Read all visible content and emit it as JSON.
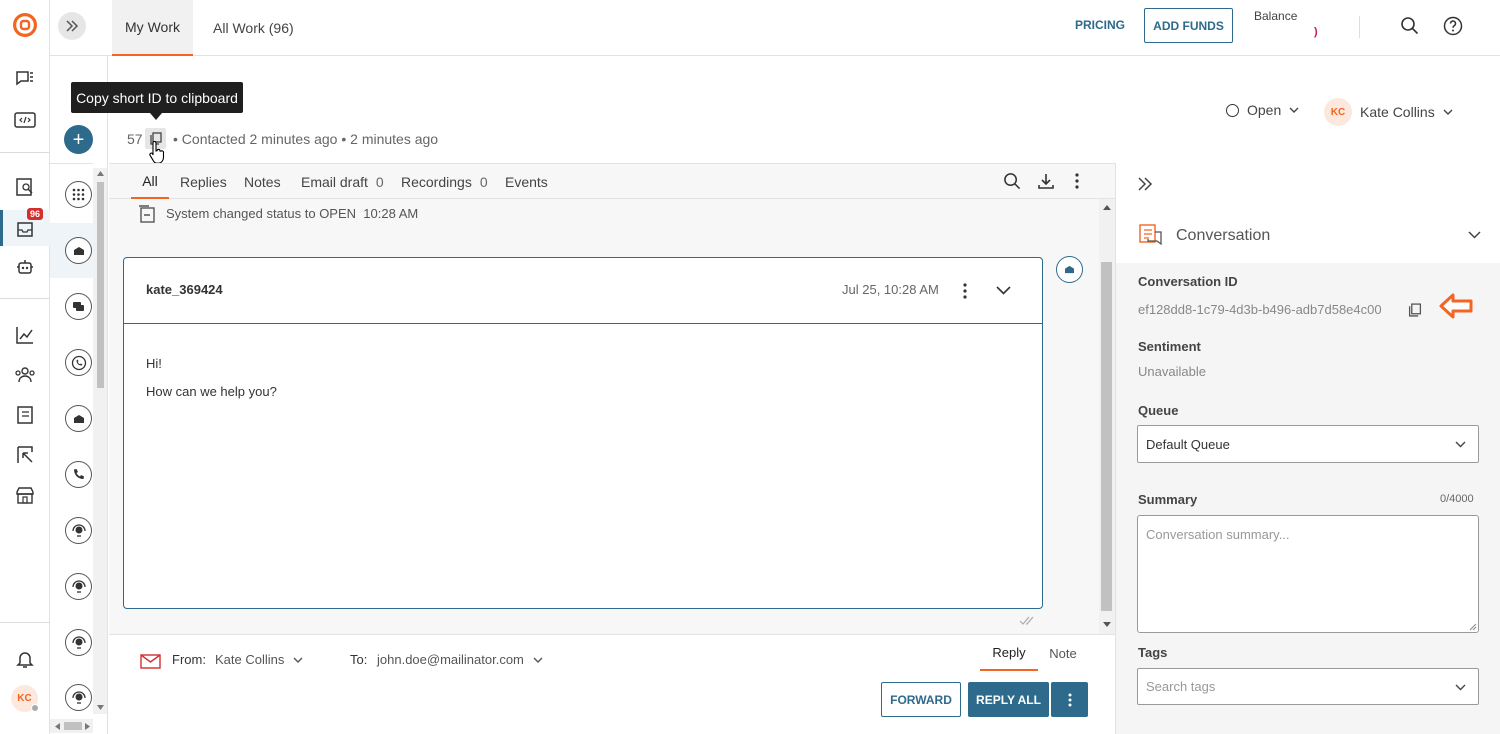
{
  "topbar": {
    "tabs": [
      {
        "label": "My Work"
      },
      {
        "label": "All Work (96)"
      }
    ],
    "pricing_label": "PRICING",
    "add_funds_label": "ADD FUNDS",
    "balance_label": "Balance",
    "balance_value": ")"
  },
  "rail": {
    "badge_count": "96",
    "avatar_initials": "KC"
  },
  "header": {
    "tooltip": "Copy short ID to clipboard",
    "short_id": "57",
    "contacted": "Contacted 2 minutes ago",
    "updated": "2 minutes ago",
    "status": "Open",
    "assignee_initials": "KC",
    "assignee": "Kate Collins"
  },
  "feed_tabs": [
    {
      "label": "All",
      "count": ""
    },
    {
      "label": "Replies",
      "count": ""
    },
    {
      "label": "Notes",
      "count": ""
    },
    {
      "label": "Email draft",
      "count": "0"
    },
    {
      "label": "Recordings",
      "count": "0"
    },
    {
      "label": "Events",
      "count": ""
    }
  ],
  "event": {
    "text": "System changed status to OPEN",
    "time": "10:28 AM"
  },
  "message": {
    "sender": "kate_369424",
    "date": "Jul 25, 10:28 AM",
    "lines": [
      "Hi!",
      "How can we help you?"
    ]
  },
  "composer": {
    "from_label": "From:",
    "from_value": "Kate Collins",
    "to_label": "To:",
    "to_value": "john.doe@mailinator.com",
    "mode_reply": "Reply",
    "mode_note": "Note",
    "forward_label": "FORWARD",
    "reply_all_label": "REPLY ALL"
  },
  "panel": {
    "section_title": "Conversation",
    "conversation_id_label": "Conversation ID",
    "conversation_id": "ef128dd8-1c79-4d3b-b496-adb7d58e4c00",
    "sentiment_label": "Sentiment",
    "sentiment_value": "Unavailable",
    "queue_label": "Queue",
    "queue_value": "Default Queue",
    "summary_label": "Summary",
    "summary_count": "0/4000",
    "summary_placeholder": "Conversation summary...",
    "tags_label": "Tags",
    "tags_placeholder": "Search tags"
  },
  "colors": {
    "brand": "#f26522",
    "accent": "#2d6a8c",
    "badge": "#d32f2f",
    "arrow": "#f26522"
  }
}
